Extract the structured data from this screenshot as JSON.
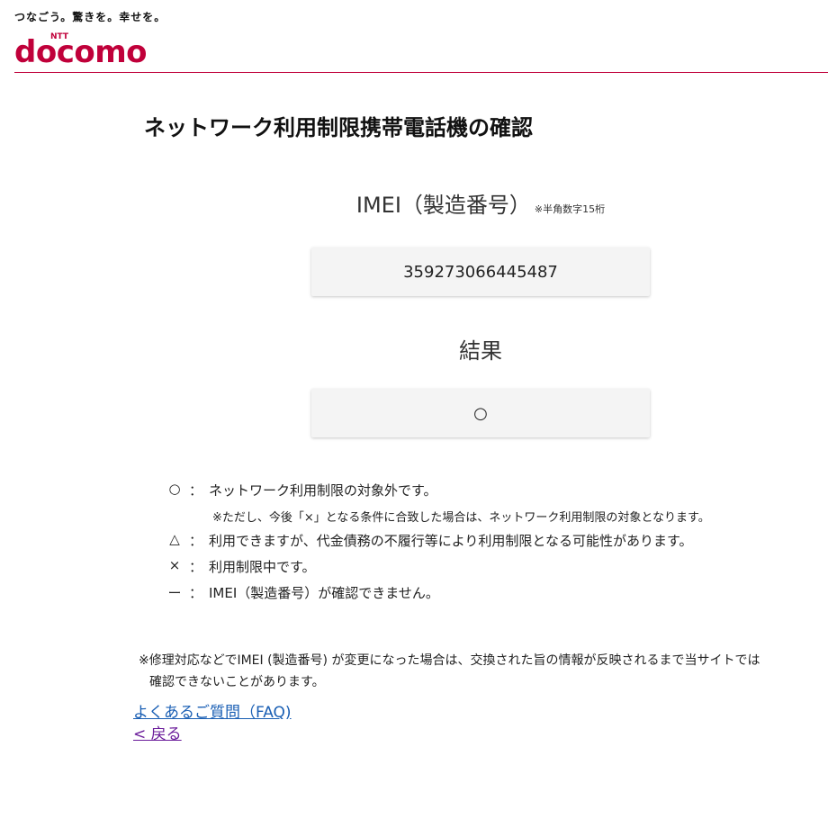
{
  "header": {
    "tagline": "つなごう。驚きを。幸せを。",
    "logo_small": "NTT",
    "logo_text": "docomo",
    "brand_color": "#c0003a"
  },
  "main": {
    "title": "ネットワーク利用制限携帯電話機の確認",
    "imei_label": "IMEI（製造番号）",
    "imei_hint": "※半角数字15桁",
    "imei_value": "359273066445487",
    "result_label": "結果",
    "result_value": "○"
  },
  "legend": {
    "items": [
      {
        "symbol": "○",
        "colon": "：",
        "text": "ネットワーク利用制限の対象外です。"
      },
      {
        "symbol": "△",
        "colon": "：",
        "text": "利用できますが、代金債務の不履行等により利用制限となる可能性があります。"
      },
      {
        "symbol": "×",
        "colon": "：",
        "text": "利用制限中です。"
      },
      {
        "symbol": "ー",
        "colon": "：",
        "text": "IMEI（製造番号）が確認できません。"
      }
    ],
    "circle_note": "※ただし、今後「×」となる条件に合致した場合は、ネットワーク利用制限の対象となります。"
  },
  "note": {
    "line1": "※修理対応などでIMEI (製造番号) が変更になった場合は、交換された旨の情報が反映されるまで当サイトでは",
    "line2": "確認できないことがあります。"
  },
  "links": {
    "faq": "よくあるご質問（FAQ)",
    "back": "< 戻る"
  }
}
